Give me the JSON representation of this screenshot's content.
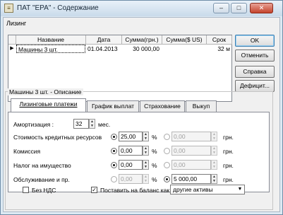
{
  "window": {
    "title": "ПАТ \"ЕРА\" - Содержание",
    "app_icon": "≡",
    "controls": {
      "minimize": "–",
      "maximize": "□",
      "close": "✕"
    }
  },
  "group": {
    "caption": "Лизинг"
  },
  "grid": {
    "columns": [
      "Название",
      "Дата",
      "Сумма(грн.)",
      "Сумма($ US)",
      "Срок"
    ],
    "rows": [
      {
        "indicator": "▶",
        "name": "Машины 3 шт.",
        "date": "01.04.2013",
        "sum_uah": "30 000,00",
        "sum_usd": "",
        "term": "32 м"
      }
    ]
  },
  "buttons": {
    "ok": "OK",
    "cancel": "Отменить",
    "help": "Справка",
    "deficit": "Дефицит..."
  },
  "description": {
    "caption": "Машины 3 шт. - Описание",
    "tabs": [
      "Лизинговые платежи",
      "График выплат",
      "Страхование",
      "Выкуп"
    ],
    "amortization": {
      "label": "Амортизация :",
      "value": "32",
      "unit": "мес."
    },
    "rows": [
      {
        "label": "Стоимость кредитных ресурсов",
        "pct_value": "25,00",
        "pct_unit": "%",
        "uah_value": "0,00",
        "uah_unit": "грн.",
        "pct_selected": true
      },
      {
        "label": "Комиссия",
        "pct_value": "0,00",
        "pct_unit": "%",
        "uah_value": "0,00",
        "uah_unit": "грн.",
        "pct_selected": true
      },
      {
        "label": "Налог на имущество",
        "pct_value": "0,00",
        "pct_unit": "%",
        "uah_value": "0,00",
        "uah_unit": "грн.",
        "pct_selected": true
      },
      {
        "label": "Обслуживание и пр.",
        "pct_value": "0,00",
        "pct_unit": "%",
        "uah_value": "5 000,00",
        "uah_unit": "грн.",
        "pct_selected": false
      }
    ],
    "no_vat": {
      "label": "Без НДС",
      "checked": false
    },
    "balance": {
      "label": "Поставить на баланс как",
      "checked": true,
      "select_value": "другие активы"
    }
  }
}
